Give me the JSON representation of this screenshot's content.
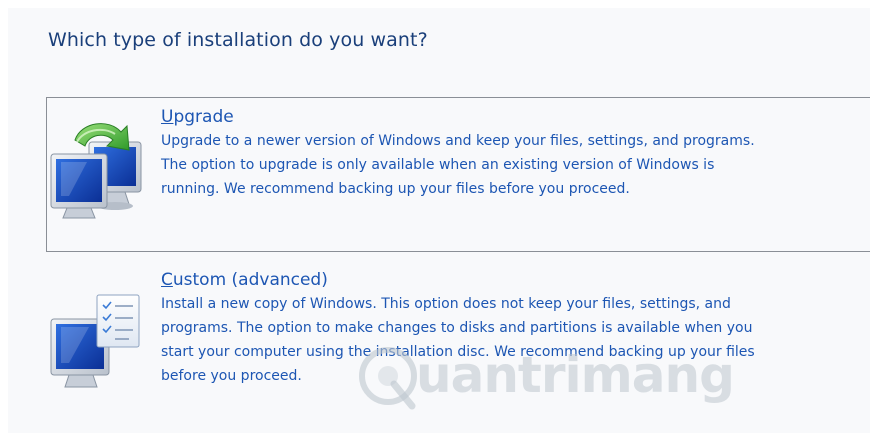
{
  "heading": "Which type of installation do you want?",
  "options": [
    {
      "id": "upgrade",
      "title_access_key": "U",
      "title_rest": "pgrade",
      "description": "Upgrade to a newer version of Windows and keep your files, settings, and programs.\nThe option to upgrade is only available when an existing version of Windows is\nrunning. We recommend backing up your files before you proceed.",
      "icon": "upgrade-computer-icon",
      "selected": true
    },
    {
      "id": "custom",
      "title_access_key": "C",
      "title_rest": "ustom (advanced)",
      "description": "Install a new copy of Windows. This option does not keep your files, settings, and\nprograms. The option to make changes to disks and partitions is available when you\nstart your computer using the installation disc. We recommend backing up your files\nbefore you proceed.",
      "icon": "custom-install-computer-icon",
      "selected": false
    }
  ],
  "watermark": {
    "text": "uantrimang",
    "logo": "quantrimang-logo"
  },
  "colors": {
    "heading": "#1a3f7a",
    "link_text": "#1d56b3",
    "selected_border": "#8a8f96",
    "background": "#f8f9fb"
  }
}
